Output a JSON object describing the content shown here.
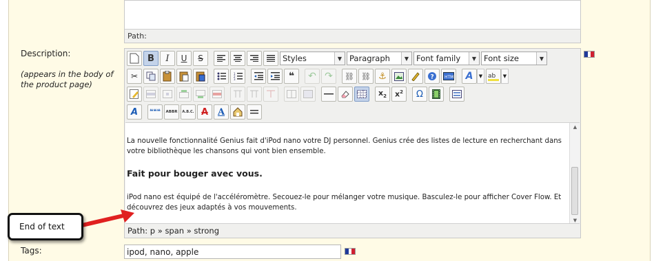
{
  "top_editor": {
    "path_label": "Path:"
  },
  "description": {
    "label": "Description:",
    "hint": "(appears in the body of the product page)"
  },
  "toolbar": {
    "styles": "Styles",
    "format": "Paragraph",
    "font_family": "Font family",
    "font_size": "Font size",
    "buttons_row1": [
      {
        "name": "new-document-icon",
        "glyph": "□"
      },
      {
        "name": "bold-icon",
        "glyph": "B"
      },
      {
        "name": "italic-icon",
        "glyph": "I"
      },
      {
        "name": "underline-icon",
        "glyph": "U"
      },
      {
        "name": "strikethrough-icon",
        "glyph": "S"
      },
      {
        "name": "align-left-icon",
        "glyph": "≡"
      },
      {
        "name": "align-center-icon",
        "glyph": "≡"
      },
      {
        "name": "align-right-icon",
        "glyph": "≡"
      },
      {
        "name": "align-justify-icon",
        "glyph": "≡"
      }
    ],
    "buttons_row2": [
      {
        "name": "cut-icon",
        "glyph": "✂"
      },
      {
        "name": "copy-icon",
        "glyph": "❐"
      },
      {
        "name": "paste-icon",
        "glyph": "📋"
      },
      {
        "name": "paste-text-icon",
        "glyph": "📋"
      },
      {
        "name": "paste-word-icon",
        "glyph": "📋"
      },
      {
        "name": "bullet-list-icon",
        "glyph": "☰"
      },
      {
        "name": "numbered-list-icon",
        "glyph": "☰"
      },
      {
        "name": "outdent-icon",
        "glyph": "⇤"
      },
      {
        "name": "indent-icon",
        "glyph": "⇥"
      },
      {
        "name": "blockquote-icon",
        "glyph": "❝"
      },
      {
        "name": "undo-icon",
        "glyph": "↶"
      },
      {
        "name": "redo-icon",
        "glyph": "↷"
      },
      {
        "name": "link-icon",
        "glyph": "⛓"
      },
      {
        "name": "unlink-icon",
        "glyph": "⛓"
      },
      {
        "name": "anchor-icon",
        "glyph": "⚓"
      },
      {
        "name": "image-icon",
        "glyph": "▣"
      },
      {
        "name": "cleanup-icon",
        "glyph": "✎"
      },
      {
        "name": "help-icon",
        "glyph": "?"
      },
      {
        "name": "html-source-icon",
        "glyph": "H"
      }
    ],
    "buttons_row3": [
      {
        "name": "edit-icon",
        "glyph": "✎"
      },
      {
        "name": "table-icon",
        "glyph": "▦"
      },
      {
        "name": "row-props-icon",
        "glyph": "▤"
      },
      {
        "name": "cell-props-icon",
        "glyph": "▤"
      },
      {
        "name": "insert-row-before-icon",
        "glyph": "▤"
      },
      {
        "name": "insert-row-after-icon",
        "glyph": "▤"
      },
      {
        "name": "delete-row-icon",
        "glyph": "▤"
      },
      {
        "name": "insert-col-before-icon",
        "glyph": "╥"
      },
      {
        "name": "insert-col-after-icon",
        "glyph": "╥"
      },
      {
        "name": "delete-col-icon",
        "glyph": "╥"
      },
      {
        "name": "split-cells-icon",
        "glyph": "▥"
      },
      {
        "name": "merge-cells-icon",
        "glyph": "▥"
      },
      {
        "name": "horizontal-rule-icon",
        "glyph": "—"
      },
      {
        "name": "remove-format-icon",
        "glyph": "⌫"
      },
      {
        "name": "visual-aid-icon",
        "glyph": "▦"
      },
      {
        "name": "subscript-icon",
        "glyph": "x₂"
      },
      {
        "name": "superscript-icon",
        "glyph": "x²"
      },
      {
        "name": "special-char-icon",
        "glyph": "Ω"
      },
      {
        "name": "media-icon",
        "glyph": "▮"
      },
      {
        "name": "template-icon",
        "glyph": "▭"
      }
    ],
    "buttons_row4": [
      {
        "name": "style-props-icon",
        "glyph": "A"
      },
      {
        "name": "cite-icon",
        "glyph": "❝❝"
      },
      {
        "name": "abbr-icon",
        "glyph": "ABBR"
      },
      {
        "name": "acronym-icon",
        "glyph": "A.B.C."
      },
      {
        "name": "del-icon",
        "glyph": "A"
      },
      {
        "name": "ins-icon",
        "glyph": "A"
      },
      {
        "name": "attributes-icon",
        "glyph": "⌂"
      },
      {
        "name": "nonbreaking-icon",
        "glyph": "≡"
      }
    ]
  },
  "content": {
    "paragraph1": "La nouvelle fonctionnalité Genius fait d'iPod nano votre DJ personnel. Genius crée des listes de lecture en recherchant dans votre bibliothèque les chansons qui vont bien ensemble.",
    "heading": "Fait pour bouger avec vous.",
    "paragraph2": "iPod nano est équipé de l'accéléromètre. Secouez-le pour mélanger votre musique. Basculez-le pour afficher Cover Flow. Et découvrez des jeux adaptés à vos mouvements."
  },
  "path_bar": "Path: p » span » strong",
  "tags": {
    "label": "Tags:",
    "value": "ipod, nano, apple"
  },
  "callout": {
    "text": "End of text"
  },
  "colors": {
    "accent_arrow": "#e02020",
    "editor_bg": "#f0f0ee",
    "page_bg": "#fffbe6"
  }
}
